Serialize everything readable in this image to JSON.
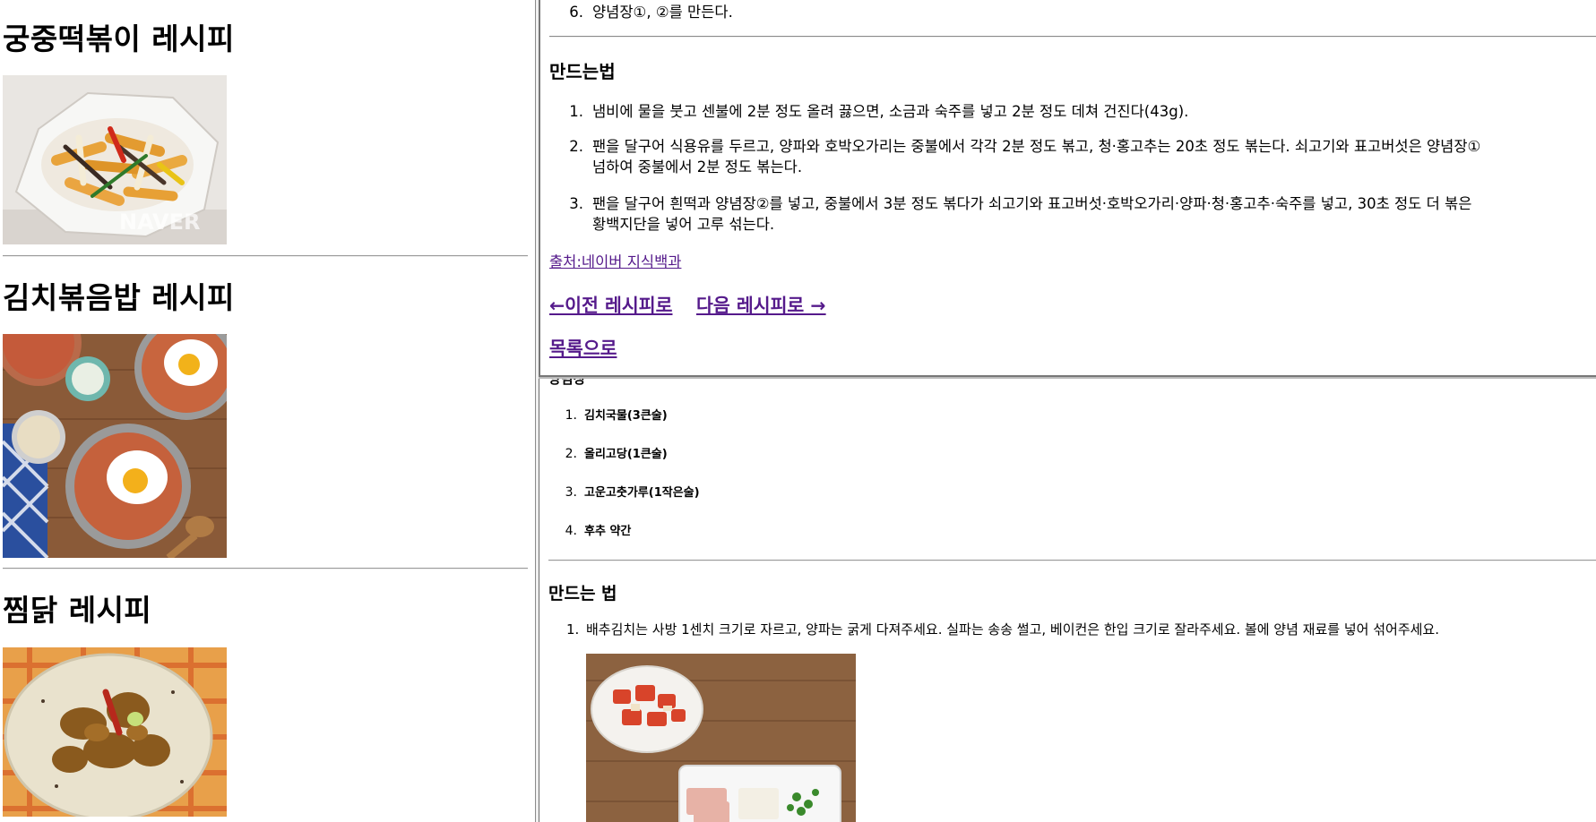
{
  "left_frame": {
    "recipes": [
      {
        "title": "궁중떡볶이 레시피",
        "image": "tteokbokki-photo",
        "watermark": "NAVER"
      },
      {
        "title": "김치볶음밥 레시피",
        "image": "kimchi-fried-rice-photo"
      },
      {
        "title": "찜닭 레시피",
        "image": "jjimdak-photo"
      }
    ]
  },
  "popup": {
    "top_step": {
      "number": "6.",
      "text": "양념장①, ②를 만든다."
    },
    "section_title": "만드는법",
    "steps": [
      {
        "number": "1.",
        "lines": [
          "냄비에 물을 붓고 센불에 2분 정도 올려 끓으면, 소금과 숙주를 넣고 2분 정도 데쳐 건진다(43g)."
        ]
      },
      {
        "number": "2.",
        "lines": [
          "팬을 달구어 식용유를 두르고, 양파와 호박오가리는 중불에서 각각 2분 정도 볶고, 청·홍고추는 20초 정도 볶는다. 쇠고기와 표고버섯은 양념장①",
          "넘하여 중불에서 2분 정도 볶는다."
        ]
      },
      {
        "number": "3.",
        "lines": [
          "팬을 달구어 흰떡과 양념장②를 넣고, 중불에서 3분 정도 볶다가 쇠고기와 표고버섯·호박오가리·양파·청·홍고추·숙주를 넣고, 30초 정도 더 볶은",
          "황백지단을 넣어 고루 섞는다."
        ]
      }
    ],
    "source_link": "출처:네이버 지식백과",
    "prev_link": "←이전 레시피로",
    "next_link": "다음 레시피로 →",
    "list_link": "목록으로"
  },
  "right_frame": {
    "partial_heading": "양념장",
    "ingredients": [
      {
        "number": "1.",
        "text": "김치국물(3큰술)"
      },
      {
        "number": "2.",
        "text": "올리고당(1큰술)"
      },
      {
        "number": "3.",
        "text": "고운고춧가루(1작은술)"
      },
      {
        "number": "4.",
        "text": "후추 약간"
      }
    ],
    "method_title": "만드는 법",
    "method_steps": [
      {
        "number": "1.",
        "text": "배추김치는 사방 1센치 크기로 자르고, 양파는 굵게 다져주세요. 실파는 송송 썰고, 베이컨은 한입 크기로 잘라주세요. 볼에 양념 재료를 넣어 섞어주세요."
      }
    ],
    "step_image": "kimchi-ingredients-photo"
  }
}
